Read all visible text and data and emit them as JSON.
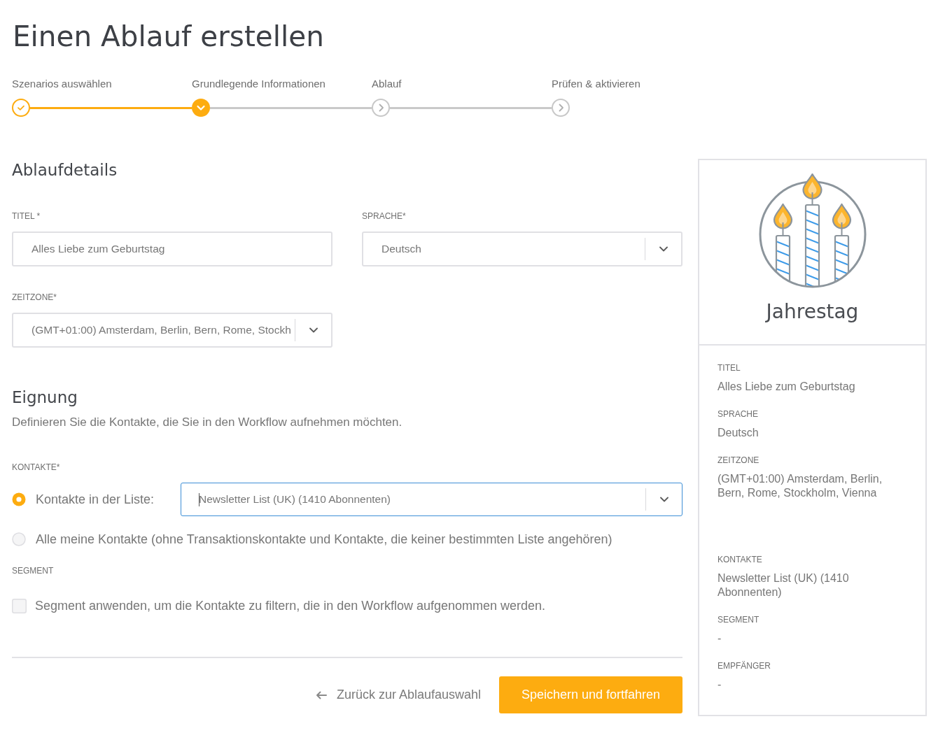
{
  "page": {
    "title": "Einen Ablauf erstellen"
  },
  "steps": [
    {
      "label": "Szenarios auswählen",
      "completed": true,
      "current": false
    },
    {
      "label": "Grundlegende Informationen",
      "completed": false,
      "current": true
    },
    {
      "label": "Ablauf",
      "completed": false,
      "current": false
    },
    {
      "label": "Prüfen & aktivieren",
      "completed": false,
      "current": false
    }
  ],
  "details": {
    "heading": "Ablaufdetails",
    "fields": [
      {
        "kind": "text",
        "label": "TITEL *",
        "value": "Alles Liebe zum Geburtstag"
      },
      {
        "kind": "select",
        "label": "SPRACHE*",
        "value": "Deutsch"
      },
      {
        "kind": "select",
        "label": "ZEITZONE*",
        "value": "(GMT+01:00) Amsterdam, Berlin, Bern, Rome, Stockh"
      }
    ]
  },
  "eligibility": {
    "heading": "Eignung",
    "description": "Definieren Sie die Kontakte, die Sie in den Workflow aufnehmen möchten.",
    "contacts_label": "KONTAKTE*",
    "options": [
      {
        "label": "Kontakte in der Liste:",
        "selected": true,
        "list_select": {
          "value": "Newsletter List (UK) (1410 Abonnenten)",
          "focused": true
        }
      },
      {
        "label": "Alle meine Kontakte (ohne Transaktionskontakte und Kontakte, die keiner bestimmten Liste angehören)",
        "selected": false
      }
    ],
    "segment_label": "SEGMENT",
    "segment_filter": {
      "label": "Segment anwenden, um die Kontakte zu filtern, die in den Workflow aufgenommen werden.",
      "checked": false
    }
  },
  "actions": {
    "back_link": "Zurück zur Ablaufauswahl",
    "save_button": "Speichern und fortfahren"
  },
  "summary": {
    "title": "Jahrestag",
    "groups": [
      {
        "items": [
          {
            "label": "TITEL",
            "value": "Alles Liebe zum Geburtstag"
          },
          {
            "label": "SPRACHE",
            "value": "Deutsch"
          },
          {
            "label": "ZEITZONE",
            "value": "(GMT+01:00) Amsterdam, Berlin, Bern, Rome, Stockholm, Vienna"
          }
        ]
      },
      {
        "items": [
          {
            "label": "KONTAKTE",
            "value": "Newsletter List (UK) (1410 Abonnenten)"
          },
          {
            "label": "SEGMENT",
            "value": "-"
          },
          {
            "label": "EMPFÄNGER",
            "value": "-"
          }
        ]
      }
    ]
  }
}
